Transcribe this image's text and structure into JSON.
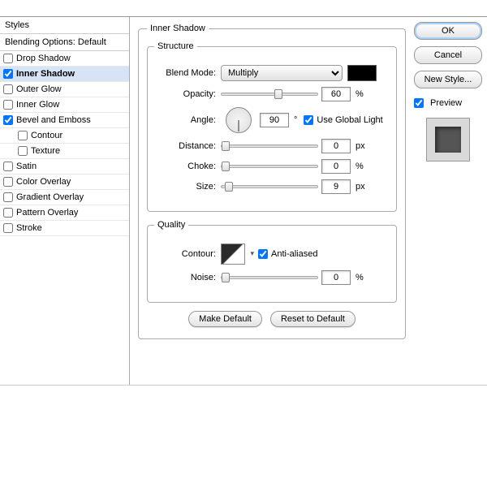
{
  "sidebar": {
    "header": "Styles",
    "subheader": "Blending Options: Default",
    "items": [
      {
        "label": "Drop Shadow",
        "checked": false,
        "selected": false
      },
      {
        "label": "Inner Shadow",
        "checked": true,
        "selected": true
      },
      {
        "label": "Outer Glow",
        "checked": false,
        "selected": false
      },
      {
        "label": "Inner Glow",
        "checked": false,
        "selected": false
      },
      {
        "label": "Bevel and Emboss",
        "checked": true,
        "selected": false
      },
      {
        "label": "Contour",
        "checked": false,
        "selected": false,
        "sub": true
      },
      {
        "label": "Texture",
        "checked": false,
        "selected": false,
        "sub": true
      },
      {
        "label": "Satin",
        "checked": false,
        "selected": false
      },
      {
        "label": "Color Overlay",
        "checked": false,
        "selected": false
      },
      {
        "label": "Gradient Overlay",
        "checked": false,
        "selected": false
      },
      {
        "label": "Pattern Overlay",
        "checked": false,
        "selected": false
      },
      {
        "label": "Stroke",
        "checked": false,
        "selected": false
      }
    ]
  },
  "panel": {
    "title": "Inner Shadow",
    "structure": {
      "legend": "Structure",
      "blend_mode_label": "Blend Mode:",
      "blend_mode_value": "Multiply",
      "color": "#000000",
      "opacity_label": "Opacity:",
      "opacity_value": "60",
      "opacity_unit": "%",
      "angle_label": "Angle:",
      "angle_value": "90",
      "angle_unit": "°",
      "global_light_label": "Use Global Light",
      "global_light_checked": true,
      "distance_label": "Distance:",
      "distance_value": "0",
      "distance_unit": "px",
      "choke_label": "Choke:",
      "choke_value": "0",
      "choke_unit": "%",
      "size_label": "Size:",
      "size_value": "9",
      "size_unit": "px"
    },
    "quality": {
      "legend": "Quality",
      "contour_label": "Contour:",
      "antialiased_label": "Anti-aliased",
      "antialiased_checked": true,
      "noise_label": "Noise:",
      "noise_value": "0",
      "noise_unit": "%"
    },
    "make_default_label": "Make Default",
    "reset_default_label": "Reset to Default"
  },
  "buttons": {
    "ok": "OK",
    "cancel": "Cancel",
    "new_style": "New Style...",
    "preview_label": "Preview",
    "preview_checked": true
  }
}
